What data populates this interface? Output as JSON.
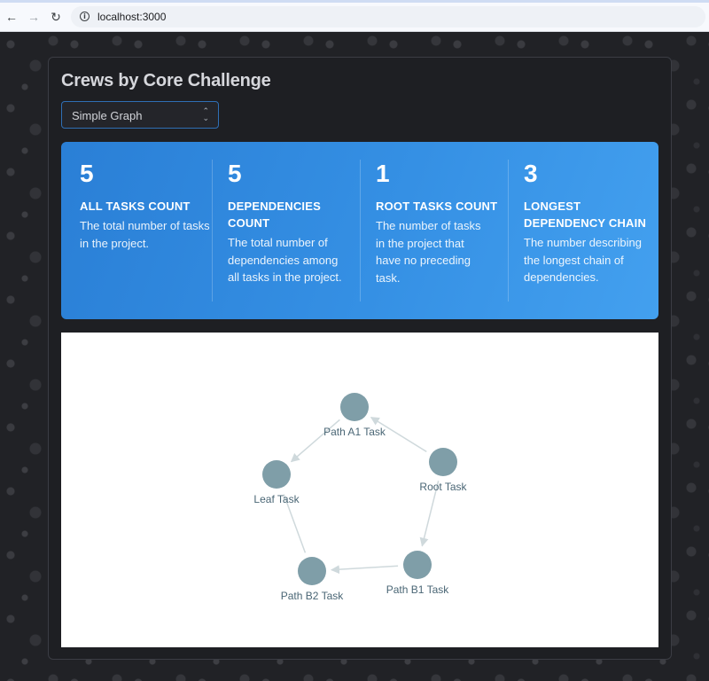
{
  "browser": {
    "url": "localhost:3000"
  },
  "page": {
    "title": "Crews by Core Challenge",
    "select": {
      "selected": "Simple Graph"
    }
  },
  "stats": [
    {
      "value": "5",
      "label": "ALL TASKS COUNT",
      "description": "The total number of tasks in the project."
    },
    {
      "value": "5",
      "label": "DEPENDENCIES COUNT",
      "description": "The total number of dependencies among all tasks in the project."
    },
    {
      "value": "1",
      "label": "ROOT TASKS COUNT",
      "description": "The number of tasks in the project that have no preceding task."
    },
    {
      "value": "3",
      "label": "LONGEST DEPENDENCY CHAIN",
      "description": "The number describing the longest chain of dependencies."
    }
  ],
  "graph": {
    "node_color": "#7f9ea8",
    "edge_color": "#cfd9dc",
    "nodes": [
      {
        "id": "root",
        "label": "Root Task"
      },
      {
        "id": "a1",
        "label": "Path A1 Task"
      },
      {
        "id": "leaf",
        "label": "Leaf Task"
      },
      {
        "id": "b1",
        "label": "Path B1 Task"
      },
      {
        "id": "b2",
        "label": "Path B2 Task"
      }
    ],
    "edges": [
      {
        "from": "root",
        "to": "a1"
      },
      {
        "from": "a1",
        "to": "leaf"
      },
      {
        "from": "root",
        "to": "b1"
      },
      {
        "from": "b1",
        "to": "b2"
      },
      {
        "from": "b2",
        "to": "leaf"
      }
    ]
  }
}
